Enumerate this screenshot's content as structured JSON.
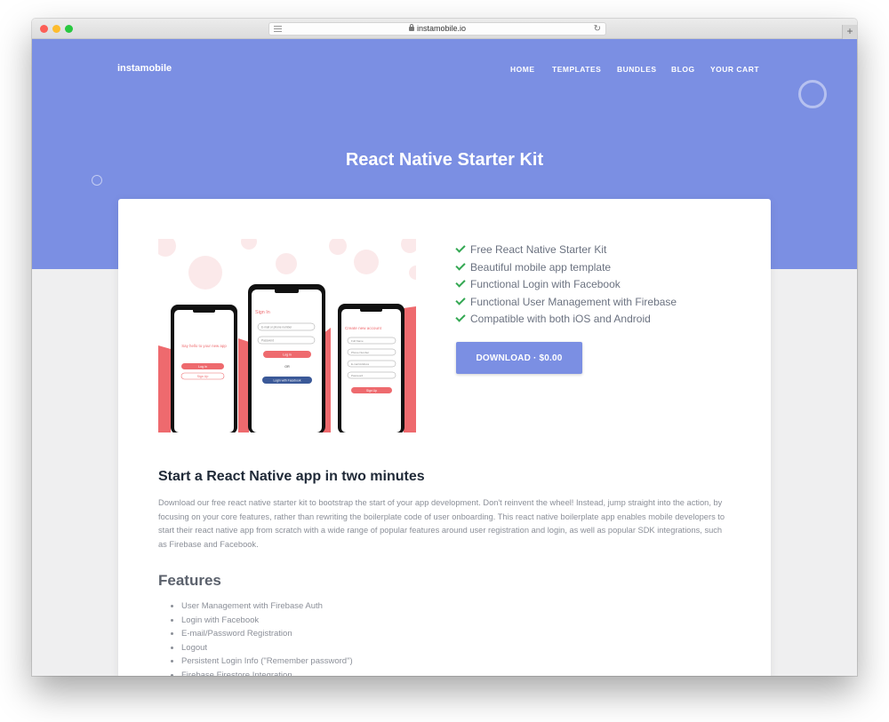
{
  "browser": {
    "url": "instamobile.io"
  },
  "header": {
    "logo": "instamobile",
    "nav": [
      "HOME",
      "TEMPLATES",
      "BUNDLES",
      "BLOG",
      "YOUR CART"
    ]
  },
  "hero": {
    "title": "React Native Starter Kit"
  },
  "product": {
    "highlights": [
      "Free React Native Starter Kit",
      "Beautiful mobile app template",
      "Functional Login with Facebook",
      "Functional User Management with Firebase",
      "Compatible with both iOS and Android"
    ],
    "download_label": "DOWNLOAD · $0.00",
    "screens": {
      "left": {
        "text": "Say hello to your new app",
        "login": "Log in",
        "signup": "Sign Up"
      },
      "middle": {
        "title": "Sign In",
        "field1": "E-mail or phone number",
        "field2": "Password",
        "login": "Log in",
        "or": "OR",
        "facebook": "Login with Facebook"
      },
      "right": {
        "title": "Create new account",
        "field1": "Full Name",
        "field2": "Phone Number",
        "field3": "E-mail Address",
        "field4": "Password",
        "signup": "Sign Up"
      }
    }
  },
  "content": {
    "section_title": "Start a React Native app in two minutes",
    "description": "Download our free react native starter kit to bootstrap the start of your app development. Don't reinvent the wheel! Instead, jump straight into the action, by focusing on your core features, rather than rewriting the boilerplate code of user onboarding. This react native boilerplate app enables mobile developers to start their react native app from scratch with a wide range of popular features around user registration and login, as well as popular SDK integrations, such as Firebase and Facebook.",
    "features_title": "Features",
    "features": [
      "User Management with Firebase Auth",
      "Login with Facebook",
      "E-mail/Password Registration",
      "Logout",
      "Persistent Login Info (\"Remember password\")",
      "Firebase Firestore Integration"
    ]
  },
  "colors": {
    "brand": "#7b8fe3",
    "accent": "#ee6a6e",
    "check": "#34a853"
  }
}
